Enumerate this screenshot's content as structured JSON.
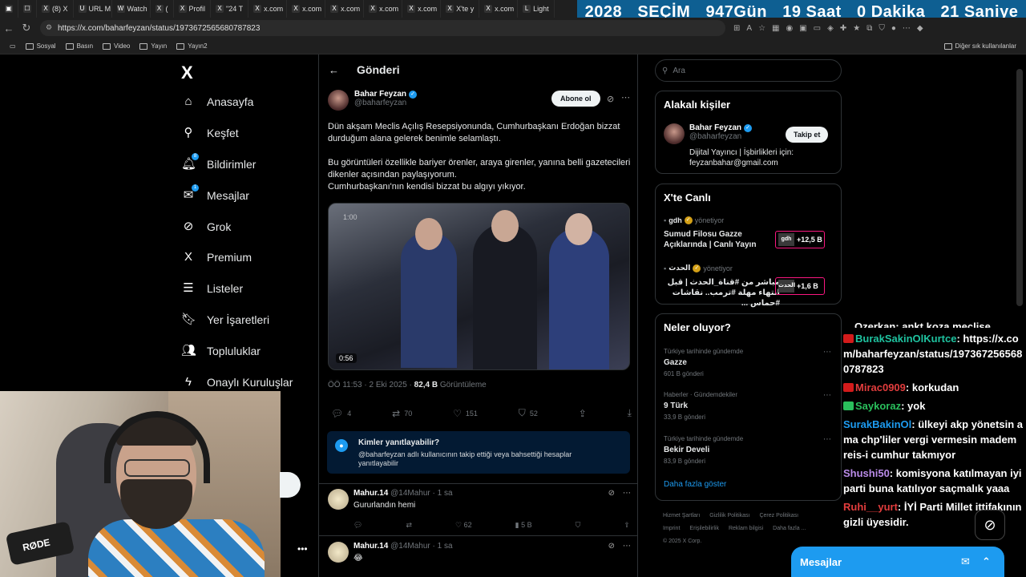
{
  "browser": {
    "tabs": [
      {
        "icon": "X",
        "label": "(8) X"
      },
      {
        "icon": "U",
        "label": "URL M"
      },
      {
        "icon": "W",
        "label": "Watch"
      },
      {
        "icon": "X",
        "label": "("
      },
      {
        "icon": "X",
        "label": "Profil"
      },
      {
        "icon": "X",
        "label": "\"24 T"
      },
      {
        "icon": "X",
        "label": "x.com"
      },
      {
        "icon": "X",
        "label": "x.com"
      },
      {
        "icon": "X",
        "label": "x.com"
      },
      {
        "icon": "X",
        "label": "x.com"
      },
      {
        "icon": "X",
        "label": "x.com"
      },
      {
        "icon": "X",
        "label": "X'te y"
      },
      {
        "icon": "X",
        "label": "x.com"
      },
      {
        "icon": "L",
        "label": "Light"
      }
    ],
    "url": "https://x.com/baharfeyzan/status/1973672565680787823",
    "bookmarks": [
      "Sosyal",
      "Basın",
      "Video",
      "Yayın",
      "Yayın2"
    ],
    "other_bookmarks": "Diğer sık kullanılanlar"
  },
  "election": {
    "year": "2028",
    "title": "SEÇİM",
    "days": "947",
    "days_label": "Gün",
    "hours": "19",
    "hours_label": "Saat",
    "minutes": "0",
    "minutes_label": "Dakika",
    "seconds": "21",
    "seconds_label": "Saniye"
  },
  "nav": {
    "logo": "X",
    "items": [
      {
        "label": "Anasayfa",
        "icon": "home-icon",
        "glyph": "⌂"
      },
      {
        "label": "Keşfet",
        "icon": "search-icon",
        "glyph": "⚲"
      },
      {
        "label": "Bildirimler",
        "icon": "bell-icon",
        "glyph": "🔔︎",
        "badge": "8"
      },
      {
        "label": "Mesajlar",
        "icon": "mail-icon",
        "glyph": "✉",
        "badge": "1"
      },
      {
        "label": "Grok",
        "icon": "grok-icon",
        "glyph": "⊘"
      },
      {
        "label": "Premium",
        "icon": "x-premium-icon",
        "glyph": "X"
      },
      {
        "label": "Listeler",
        "icon": "list-icon",
        "glyph": "☰"
      },
      {
        "label": "Yer İşaretleri",
        "icon": "bookmark-icon",
        "glyph": "🔖︎"
      },
      {
        "label": "Topluluklar",
        "icon": "communities-icon",
        "glyph": "👥︎"
      },
      {
        "label": "Onaylı Kuruluşlar",
        "icon": "lightning-icon",
        "glyph": "ϟ"
      }
    ]
  },
  "post": {
    "header": "Gönderi",
    "author_name": "Bahar Feyzan",
    "author_handle": "@baharfeyzan",
    "subscribe_label": "Abone ol",
    "paragraph1": "Dün akşam Meclis Açılış Resepsiyonunda, Cumhurbaşkanı Erdoğan bizzat durduğum alana gelerek benimle selamlaştı.",
    "paragraph2": "Bu görüntüleri özellikle bariyer örenler, araya girenler, yanına belli gazetecileri dikenler açısından paylaşıyorum.",
    "paragraph3": "Cumhurbaşkanı'nın kendisi bizzat bu algıyı yıkıyor.",
    "video_top_time": "1:00",
    "video_duration": "0:56",
    "timestamp": "ÖÖ 11:53 · 2 Eki 2025 · ",
    "views": "82,4 B",
    "views_label": " Görüntüleme",
    "replies": "4",
    "reposts": "70",
    "likes": "151",
    "bookmarks": "52",
    "who_can_reply_title": "Kimler yanıtlayabilir?",
    "who_can_reply_desc": "@baharfeyzan adlı kullanıcının takip ettiği veya bahsettiği hesaplar yanıtlayabilir"
  },
  "replies": [
    {
      "name": "Mahur.14",
      "handle": "@14Mahur · 1 sa",
      "text": "Gururlandın hemi",
      "likes": "62",
      "views": "5 B"
    },
    {
      "name": "Mahur.14",
      "handle": "@14Mahur · 1 sa",
      "text": "😂"
    }
  ],
  "right": {
    "search_placeholder": "Ara",
    "related_title": "Alakalı kişiler",
    "related_name": "Bahar Feyzan",
    "related_handle": "@baharfeyzan",
    "related_bio": "Dijital Yayıncı | İşbirlikleri için: feyzanbahar@gmail.com",
    "follow_label": "Takip et",
    "live_title": "X'te Canlı",
    "live": [
      {
        "host": "gdh",
        "hosting": " yönetiyor",
        "title": "Sumud Filosu Gazze Açıklarında | Canlı Yayın",
        "badge": "gdh",
        "count": "+12,5 B"
      },
      {
        "host": "الحدث",
        "hosting": " yönetiyor",
        "title": "مباشر من #قناة_الحدث | قبل انتهاء مهلة #ترمب.. نقاشات #حماس ...",
        "badge": "الحدث",
        "count": "+1,6 B"
      }
    ],
    "trends_title": "Neler oluyor?",
    "trends": [
      {
        "category": "Türkiye tarihinde gündemde",
        "name": "Gazze",
        "count": "601 B gönderi"
      },
      {
        "category": "Haberler · Gündemdekiler",
        "name": "9 Türk",
        "count": "33,9 B gönderi"
      },
      {
        "category": "Türkiye tarihinde gündemde",
        "name": "Bekir Develi",
        "count": "83,9 B gönderi"
      }
    ],
    "show_more": "Daha fazla göster",
    "footer": [
      "Hizmet Şartları",
      "Gizlilik Politikası",
      "Çerez Politikası",
      "Imprint",
      "Erişilebilirlik",
      "Reklam bilgisi",
      "Daha fazla ...",
      "© 2025 X Corp."
    ]
  },
  "chat": {
    "cutoff": "Ozerkan: ankt koza meclise",
    "messages": [
      {
        "user": "BurakSakinOlKurtce",
        "color": "#1fc3a0",
        "badge": "r",
        "text": "https://x.com/baharfeyzan/status/1973672565680787823"
      },
      {
        "user": "Mirac0909",
        "color": "#e23d3d",
        "badge": "r",
        "text": "korkudan"
      },
      {
        "user": "Saykoraz",
        "color": "#2abf5c",
        "badge": "g",
        "text": "yok"
      },
      {
        "user": "SurakBakinOl",
        "color": "#1d9bf0",
        "badge": "",
        "text": "ülkeyi akp yönetsin ama chp'liler vergi vermesin madem reis-i cumhur takmıyor"
      },
      {
        "user": "Shushi50",
        "color": "#b98be8",
        "badge": "",
        "text": "komisyona katılmayan iyi parti buna katılıyor saçmalık yaaa"
      },
      {
        "user": "Ruhi__yurt",
        "color": "#e23d3d",
        "badge": "",
        "text": "İYİ Parti Millet ittifakının gizli üyesidir."
      }
    ]
  },
  "dock": {
    "label": "Mesajlar"
  },
  "webcam": {
    "mic_brand": "RØDE"
  }
}
